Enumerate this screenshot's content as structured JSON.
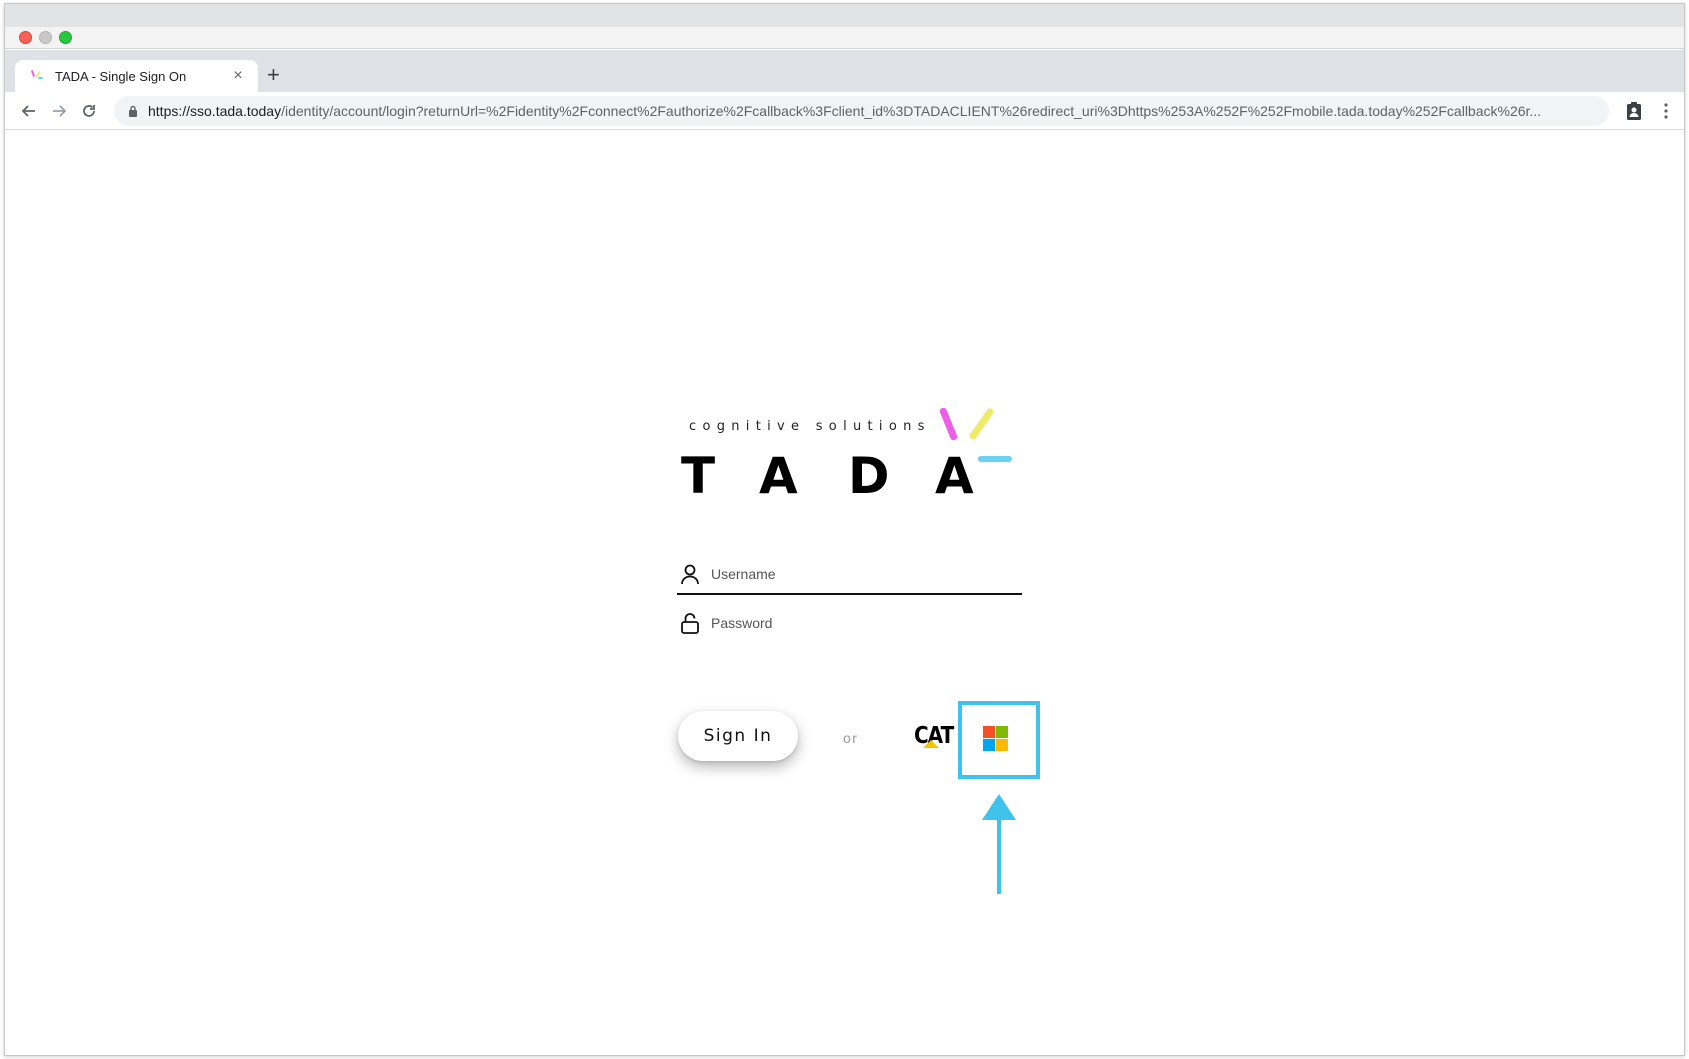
{
  "browser": {
    "tab_title": "TADA - Single Sign On",
    "tab_close": "×",
    "new_tab": "+",
    "url_host": "https://sso.tada.today",
    "url_path": "/identity/account/login?returnUrl=%2Fidentity%2Fconnect%2Fauthorize%2Fcallback%3Fclient_id%3DTADACLIENT%26redirect_uri%3Dhttps%253A%252F%252Fmobile.tada.today%252Fcallback%26r..."
  },
  "logo": {
    "tagline": "cognitive solutions",
    "letters": [
      "T",
      "A",
      "D",
      "A"
    ],
    "spark_colors": [
      "#ee5fe9",
      "#efeb6a",
      "#69d3f2"
    ]
  },
  "form": {
    "username_placeholder": "Username",
    "password_placeholder": "Password",
    "signin_label": "Sign In",
    "or_label": "or"
  },
  "providers": {
    "cat_label": "CAT",
    "ms_colors": [
      "#f25022",
      "#7fba00",
      "#00a4ef",
      "#ffb900"
    ]
  },
  "annotation": {
    "color": "#3fc3ec"
  }
}
